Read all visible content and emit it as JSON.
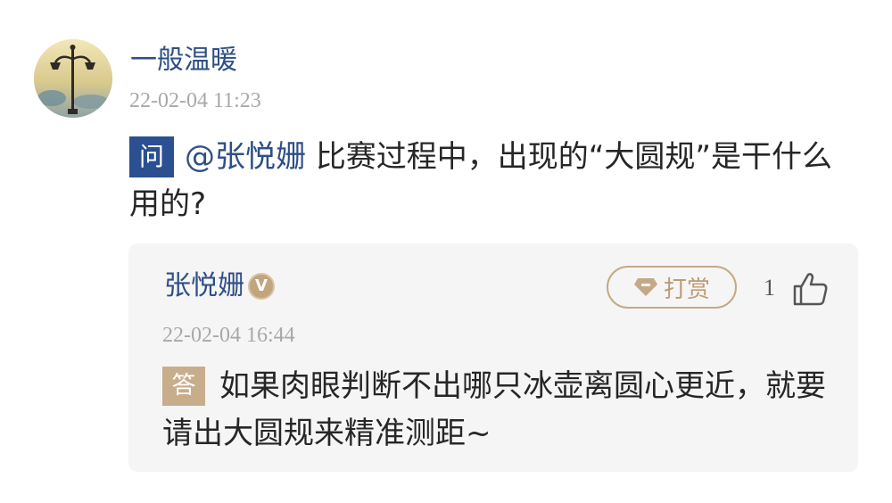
{
  "question_post": {
    "user_name": "一般温暖",
    "timestamp": "22-02-04 11:23",
    "badge": "问",
    "mention": "@张悦姗",
    "text": "比赛过程中，出现的“大圆规”是干什么用的?"
  },
  "answer_post": {
    "user_name": "张悦姗",
    "verified_badge": "V",
    "tip_label": "打赏",
    "like_count": "1",
    "timestamp": "22-02-04 16:44",
    "badge": "答",
    "text": "如果肉眼判断不出哪只冰壶离圆心更近，就要请出大圆规来精准测距~"
  },
  "icons": {
    "avatar": "street-lamp-avatar",
    "verified": "verified-v-icon",
    "tip": "diamond-icon",
    "like": "thumbs-up-icon"
  },
  "colors": {
    "name_blue": "#2f4f86",
    "question_badge": "#2a5091",
    "answer_badge": "#c8ad8c",
    "tip_gold": "#bd9c75",
    "card_bg": "#f5f5f5",
    "timestamp_gray": "#a8a8a8"
  }
}
